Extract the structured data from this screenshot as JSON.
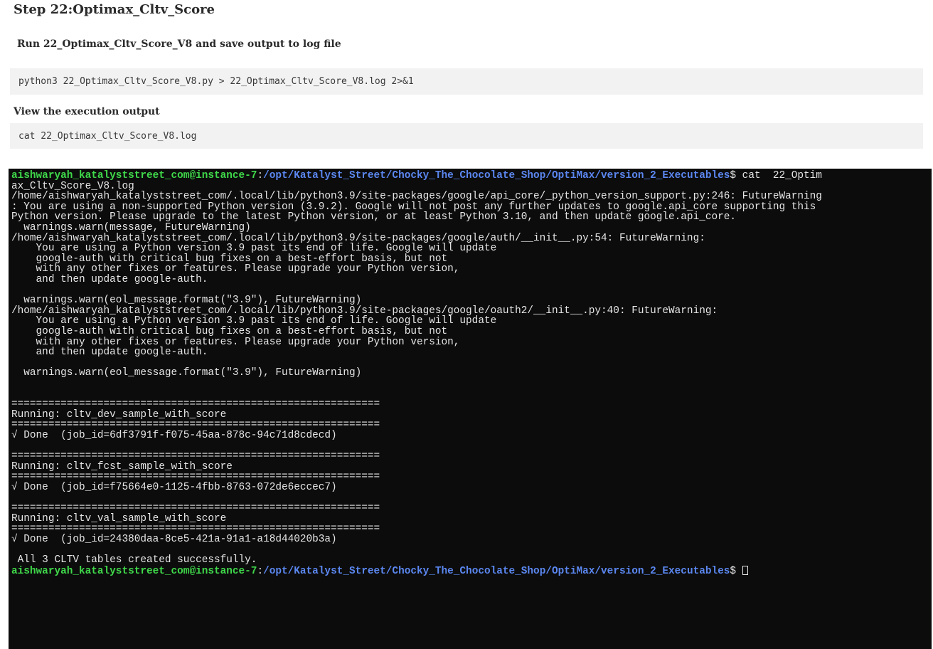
{
  "page": {
    "step_title": "Step 22:Optimax_Cltv_Score",
    "run_label": "Run 22_Optimax_Cltv_Score_V8 and save output to log file",
    "run_command": "python3 22_Optimax_Cltv_Score_V8.py > 22_Optimax_Cltv_Score_V8.log 2>&1",
    "view_label": "View the execution output",
    "view_command": "cat 22_Optimax_Cltv_Score_V8.log"
  },
  "terminal": {
    "prompt_user": "aishwaryah_katalyststreet_com@instance-7",
    "prompt_colon": ":",
    "prompt_path": "/opt/Katalyst_Street/Chocky_The_Chocolate_Shop/OptiMax/version_2_Executables",
    "prompt_symbol": "$",
    "first_command": " cat  22_Optim",
    "lines": [
      "ax_Cltv_Score_V8.log",
      "/home/aishwaryah_katalyststreet_com/.local/lib/python3.9/site-packages/google/api_core/_python_version_support.py:246: FutureWarning",
      ": You are using a non-supported Python version (3.9.2). Google will not post any further updates to google.api_core supporting this",
      "Python version. Please upgrade to the latest Python version, or at least Python 3.10, and then update google.api_core.",
      "  warnings.warn(message, FutureWarning)",
      "/home/aishwaryah_katalyststreet_com/.local/lib/python3.9/site-packages/google/auth/__init__.py:54: FutureWarning:",
      "    You are using a Python version 3.9 past its end of life. Google will update",
      "    google-auth with critical bug fixes on a best-effort basis, but not",
      "    with any other fixes or features. Please upgrade your Python version,",
      "    and then update google-auth.",
      "",
      "  warnings.warn(eol_message.format(\"3.9\"), FutureWarning)",
      "/home/aishwaryah_katalyststreet_com/.local/lib/python3.9/site-packages/google/oauth2/__init__.py:40: FutureWarning:",
      "    You are using a Python version 3.9 past its end of life. Google will update",
      "    google-auth with critical bug fixes on a best-effort basis, but not",
      "    with any other fixes or features. Please upgrade your Python version,",
      "    and then update google-auth.",
      "",
      "  warnings.warn(eol_message.format(\"3.9\"), FutureWarning)",
      "",
      "",
      "============================================================",
      "Running: cltv_dev_sample_with_score",
      "============================================================",
      "√ Done  (job_id=6df3791f-f075-45aa-878c-94c71d8cdecd)",
      "",
      "============================================================",
      "Running: cltv_fcst_sample_with_score",
      "============================================================",
      "√ Done  (job_id=f75664e0-1125-4fbb-8763-072de6eccec7)",
      "",
      "============================================================",
      "Running: cltv_val_sample_with_score",
      "============================================================",
      "√ Done  (job_id=24380daa-8ce5-421a-91a1-a18d44020b3a)",
      "",
      " All 3 CLTV tables created successfully."
    ],
    "colors": {
      "background": "#0c0c0c",
      "text": "#e6e6e6",
      "prompt_user": "#3fd84a",
      "prompt_path": "#5b87f0"
    }
  }
}
